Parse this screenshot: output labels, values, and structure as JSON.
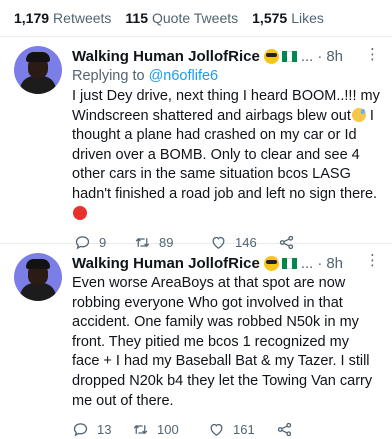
{
  "stats": {
    "retweets": {
      "count": "1,179",
      "label": "Retweets"
    },
    "quotes": {
      "count": "115",
      "label": "Quote Tweets"
    },
    "likes": {
      "count": "1,575",
      "label": "Likes"
    }
  },
  "tweets": [
    {
      "name": "Walking Human JollofRice",
      "ellipsis": "...",
      "separator": "·",
      "time": "8h",
      "more": "⋮",
      "replying_prefix": "Replying to ",
      "replying_handle": "@n6oflife6",
      "text_part1": "I just Dey drive, next thing I heard BOOM..!!! my Windscreen shattered and airbags blew out",
      "text_part2": " I thought a plane had crashed on my car or Id driven over a BOMB. Only to clear and see 4 other cars in the same situation bcos LASG hadn't finished a road job and left no sign there.",
      "replies": "9",
      "retweets": "89",
      "likes": "146"
    },
    {
      "name": "Walking Human JollofRice",
      "ellipsis": "...",
      "separator": "·",
      "time": "8h",
      "more": "⋮",
      "text": "Even worse AreaBoys at that spot are now robbing everyone Who got involved in that accident. One family was robbed N50k in my front. They pitied me bcos 1 recognized my face + I had my Baseball Bat & my Tazer. I still dropped N20k b4 they let the Towing Van carry me out of there.",
      "replies": "13",
      "retweets": "100",
      "likes": "161"
    }
  ],
  "colors": {
    "text": "#0f1419",
    "muted": "#536471",
    "link": "#1d9bf0",
    "divider": "#e6ecf0"
  },
  "icons": [
    "emoji-sunglasses-icon",
    "nigeria-flag-icon",
    "sweat-emoji-icon",
    "angry-emoji-icon",
    "reply-icon",
    "retweet-icon",
    "like-icon",
    "share-icon",
    "more-icon"
  ]
}
